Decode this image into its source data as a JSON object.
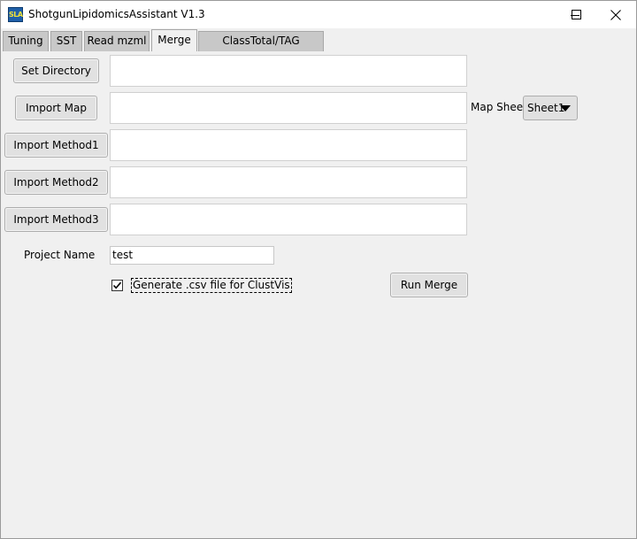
{
  "window": {
    "title": "ShotgunLipidomicsAssistant V1.3",
    "icon_text": "SLA",
    "controls": [
      "minimize-icon",
      "maximize-icon",
      "close-icon"
    ]
  },
  "tabs": [
    {
      "label": "Tuning",
      "active": false
    },
    {
      "label": "SST",
      "active": false
    },
    {
      "label": "Read mzml",
      "active": false
    },
    {
      "label": "Merge",
      "active": true
    },
    {
      "label": "ClassTotal/TAG Analysis",
      "active": false
    }
  ],
  "merge": {
    "set_directory_label": "Set Directory",
    "set_directory_value": "",
    "import_map_label": "Import Map",
    "import_map_value": "",
    "map_sheet_label": "Map Sheet",
    "map_sheet_selected": "Sheet1",
    "import_method1_label": "Import Method1",
    "import_method1_value": "",
    "import_method2_label": "Import Method2",
    "import_method2_value": "",
    "import_method3_label": "Import Method3",
    "import_method3_value": "",
    "project_name_label": "Project Name",
    "project_name_value": "test",
    "csv_checkbox_label": "Generate .csv file for ClustVis",
    "csv_checkbox_checked": true,
    "run_merge_label": "Run Merge"
  },
  "colors": {
    "window_bg": "#f0f0f0",
    "tab_inactive": "#c8c8c8",
    "button_bg": "#e1e1e1"
  }
}
